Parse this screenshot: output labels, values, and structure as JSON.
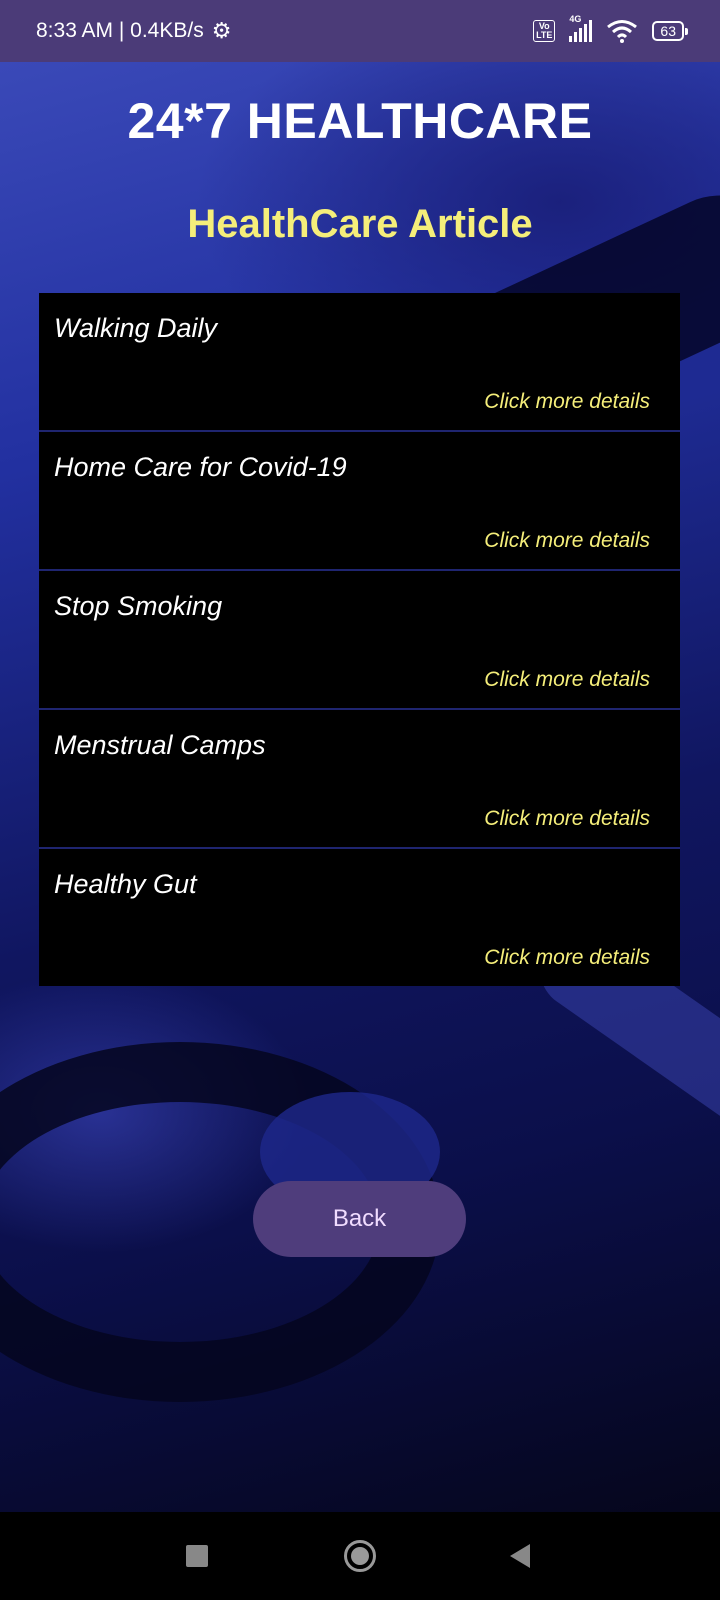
{
  "status_bar": {
    "time_speed": "8:33 AM | 0.4KB/s",
    "volte_top": "Vo",
    "volte_bottom": "LTE",
    "network": "4G",
    "battery": "63"
  },
  "header": {
    "app_title": "24*7 HEALTHCARE",
    "section_title": "HealthCare Article"
  },
  "articles": [
    {
      "title": "Walking Daily",
      "link": "Click more details"
    },
    {
      "title": "Home Care for Covid-19",
      "link": "Click more details"
    },
    {
      "title": "Stop Smoking",
      "link": "Click more details"
    },
    {
      "title": "Menstrual Camps",
      "link": "Click more details"
    },
    {
      "title": "Healthy Gut",
      "link": "Click more details"
    }
  ],
  "back_button": {
    "label": "Back"
  },
  "icons": {
    "settings": "gear-icon",
    "signal": "signal-icon",
    "wifi": "wifi-icon",
    "battery": "battery-icon",
    "nav_recent": "square-icon",
    "nav_home": "circle-icon",
    "nav_back": "triangle-back-icon"
  },
  "colors": {
    "status_bar": "#4b3b78",
    "title_accent": "#f5ee7a",
    "card_bg": "#000000",
    "button_bg": "#4f3d7c"
  }
}
